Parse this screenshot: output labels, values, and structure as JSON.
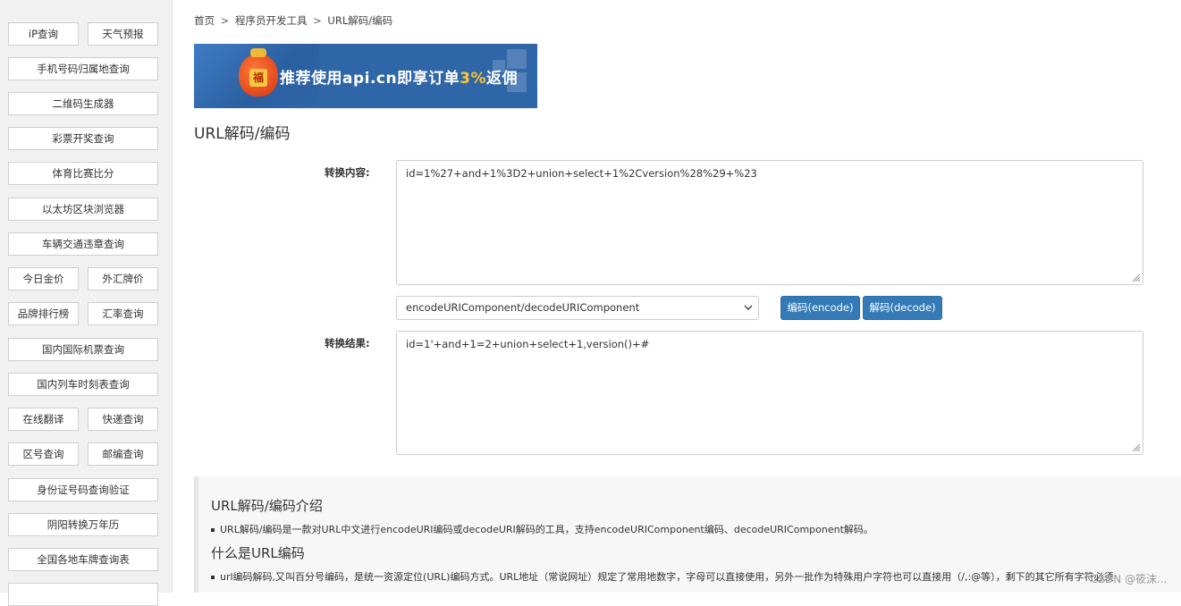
{
  "sidebar": {
    "items": [
      "iP查询",
      "天气预报",
      "手机号码归属地查询",
      "二维码生成器",
      "彩票开奖查询",
      "体育比赛比分",
      "以太坊区块浏览器",
      "车辆交通违章查询",
      "今日金价",
      "外汇牌价",
      "品牌排行榜",
      "汇率查询",
      "国内国际机票查询",
      "国内列车时刻表查询",
      "在线翻译",
      "快递查询",
      "区号查询",
      "邮编查询",
      "身份证号码查询验证",
      "阴阳转换万年历",
      "全国各地车牌查询表"
    ]
  },
  "breadcrumb": {
    "home": "首页",
    "sep": ">",
    "tools": "程序员开发工具",
    "current": "URL解码/编码"
  },
  "banner": {
    "fu": "福",
    "text_pre": "推荐使用api.cn即享订单",
    "text_highlight": "3%",
    "text_post": "返佣"
  },
  "page": {
    "title": "URL解码/编码"
  },
  "form": {
    "input_label": "转换内容:",
    "input_value": "id=1%27+and+1%3D2+union+select+1%2Cversion%28%29+%23",
    "select_value": "encodeURIComponent/decodeURIComponent",
    "encode_label": "编码(encode)",
    "decode_label": "解码(decode)",
    "result_label": "转换结果:",
    "result_value": "id=1'+and+1=2+union+select+1,version()+#"
  },
  "intro": {
    "heading1": "URL解码/编码介绍",
    "para1": "URL解码/编码是一款对URL中文进行encodeURI编码或decodeURI解码的工具，支持encodeURIComponent编码、decodeURIComponent解码。",
    "heading2": "什么是URL编码",
    "para2": "url编码解码,又叫百分号编码，是统一资源定位(URL)编码方式。URL地址（常说网址）规定了常用地数字，字母可以直接使用，另外一批作为特殊用户字符也可以直接用（/,:@等），剩下的其它所有字符必须"
  },
  "watermark": "CSDN @筱沫..."
}
